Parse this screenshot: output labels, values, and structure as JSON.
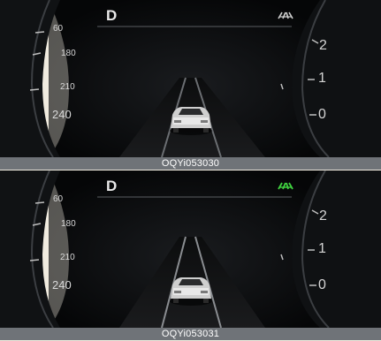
{
  "panels": [
    {
      "gear": "D",
      "lane_assist_icon": "lane-assist-icon",
      "lane_assist_state": "inactive",
      "lane_assist_color": "#cfcfcf",
      "speed_ticks": [
        "60",
        "180",
        "210",
        "240"
      ],
      "rpm_ticks": [
        "2",
        "1",
        "0"
      ],
      "caption": "OQYi053030"
    },
    {
      "gear": "D",
      "lane_assist_icon": "lane-assist-icon",
      "lane_assist_state": "active",
      "lane_assist_color": "#3fd13f",
      "speed_ticks": [
        "60",
        "180",
        "210",
        "240"
      ],
      "rpm_ticks": [
        "2",
        "1",
        "0"
      ],
      "caption": "OQYi053031"
    }
  ]
}
